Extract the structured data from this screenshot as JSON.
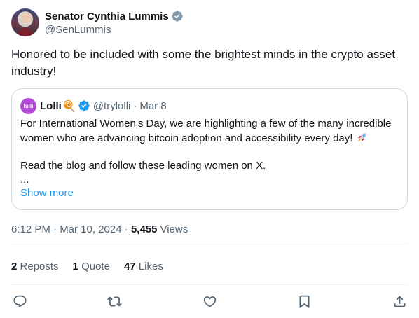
{
  "author": {
    "display_name": "Senator Cynthia Lummis",
    "handle": "@SenLummis",
    "verified_color": "#829aab"
  },
  "tweet": {
    "text": "Honored to be included with some the brightest minds in the crypto asset industry!"
  },
  "quote": {
    "avatar_text": "lolli",
    "avatar_color": "#b34bd6",
    "name": "Lolli",
    "handle": "@trylolli",
    "separator": "·",
    "date": "Mar 8",
    "verified_color": "#1d9bf0",
    "lines": [
      "For International Women’s Day, we are highlighting a few of the many incredible",
      "women who are advancing bitcoin adoption and accessibility every day!",
      "",
      "Read the blog and follow these leading women on X.",
      "..."
    ],
    "show_more": "Show more"
  },
  "meta": {
    "time": "6:12 PM · Mar 10, 2024",
    "sep": " · ",
    "views_count": "5,455",
    "views_label": "Views"
  },
  "stats": {
    "reposts_count": "2",
    "reposts_label": "Reposts",
    "quotes_count": "1",
    "quotes_label": "Quote",
    "likes_count": "47",
    "likes_label": "Likes"
  },
  "icons": {
    "reply": "reply-icon",
    "repost": "repost-icon",
    "like": "like-icon",
    "bookmark": "bookmark-icon",
    "share": "share-icon"
  },
  "colors": {
    "link": "#1d9bf0",
    "secondary_text": "#536471",
    "primary_text": "#0f1419"
  }
}
